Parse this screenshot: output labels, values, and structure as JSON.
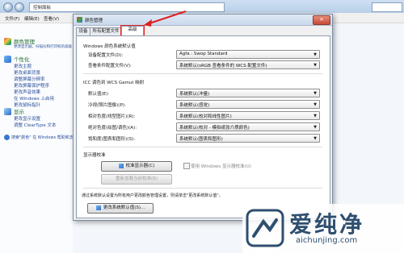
{
  "explorer": {
    "address": "控制面板",
    "menu": [
      "文件(F)",
      "编辑(E)",
      "查看(V)",
      "工具(T)",
      "帮助(H)"
    ],
    "categories": [
      {
        "title": "颜色管理",
        "links": [
          "更改显示器，扫描仪和打印机的高级颜色管理设置"
        ]
      },
      {
        "title": "个性化",
        "links": [
          "更改主题",
          "更改桌面背景",
          "调整屏幕分辨率",
          "更改屏幕保护程序",
          "更改声音效果",
          "在 Windows 上启用",
          "更改鼠标指针"
        ]
      },
      {
        "title": "显示",
        "links": [
          "更改显示设置",
          "调整 ClearType 文本"
        ]
      }
    ],
    "search_hint": "搜索\"颜色\" 在 Windows 帮助和支持"
  },
  "dialog": {
    "title": "颜色管理",
    "close": "✕",
    "tabs": [
      "设备",
      "所有配置文件",
      "高级"
    ],
    "group1": {
      "label": "Windows 颜色系统默认值",
      "rows": [
        {
          "label": "设备配置文件(D):",
          "value": "Agfa : Swop Standard"
        },
        {
          "label": "查看条件配置文件(V):",
          "value": "系统默认(sRGB 查看条件的 WCS 配置文件)"
        }
      ]
    },
    "group2": {
      "label": "ICC 调色到 WCS Gamut 映射",
      "rows": [
        {
          "label": "默认值(E):",
          "value": "系统默认(冲量)"
        },
        {
          "label": "冷视(照片图像)(P):",
          "value": "系统默认(感觉)"
        },
        {
          "label": "相对色度(线型图片)(R):",
          "value": "系统默认(校对和线性图片)"
        },
        {
          "label": "绝对色度(绘图/调色)(A):",
          "value": "系统默认(校对 - 模拟纸张介质颜色)"
        },
        {
          "label": "饱和度(图表和图形)(S):",
          "value": "系统默认(图表和图形)"
        }
      ]
    },
    "group3": {
      "label": "显示器校准",
      "calibrate": "校准显示器(C)",
      "use_windows_calibration": "使用 Windows 显示器校准(U)",
      "reload": "重新加载当前校准(R)"
    },
    "note": "通过系统默认设置为所有用户更改颜色管理设置，则请单击\"更改系统默认值\"。",
    "change_defaults": "更改系统默认值(S)..."
  },
  "watermark": {
    "cn": "爱纯净",
    "url": "aichunjing.com"
  },
  "colors": {
    "highlight": "#e02020",
    "link": "#2a4e9a"
  }
}
